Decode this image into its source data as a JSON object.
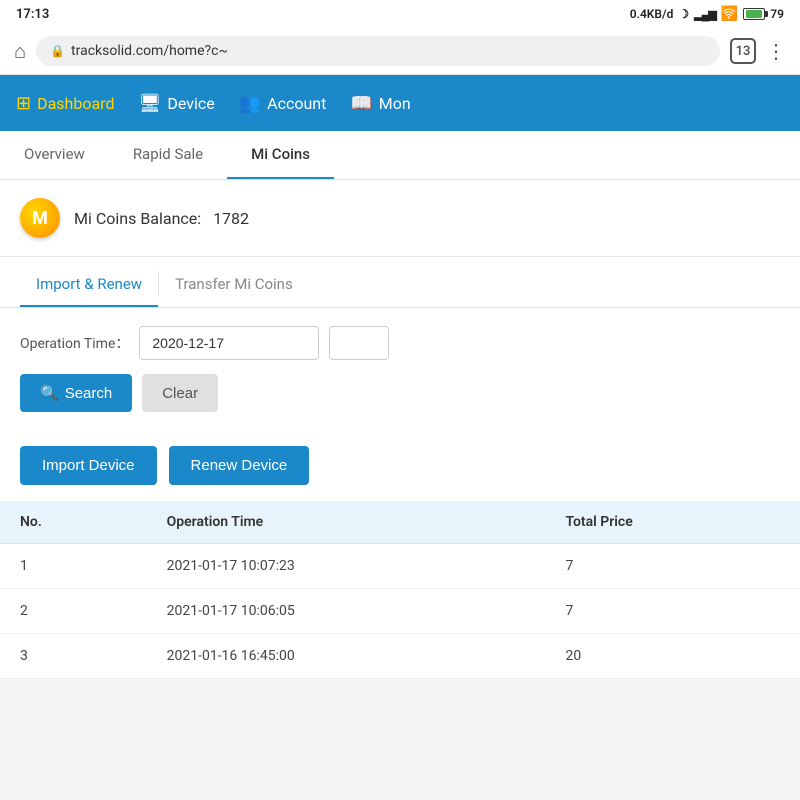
{
  "statusBar": {
    "time": "17:13",
    "network": "0.4KB/d",
    "batteryPercent": "79",
    "tabCount": "13"
  },
  "browserBar": {
    "url": "tracksolid.com/home?c~"
  },
  "nav": {
    "items": [
      {
        "id": "dashboard",
        "label": "Dashboard",
        "icon": "📊",
        "active": false
      },
      {
        "id": "device",
        "label": "Device",
        "icon": "📦",
        "active": false
      },
      {
        "id": "account",
        "label": "Account",
        "icon": "👥",
        "active": true
      },
      {
        "id": "monitor",
        "label": "Mon",
        "icon": "📖",
        "active": false
      }
    ]
  },
  "tabs": [
    {
      "id": "overview",
      "label": "Overview",
      "active": false
    },
    {
      "id": "rapid-sale",
      "label": "Rapid Sale",
      "active": false
    },
    {
      "id": "mi-coins",
      "label": "Mi Coins",
      "active": true
    }
  ],
  "balance": {
    "label": "Mi Coins Balance:",
    "amount": "1782",
    "coinSymbol": "M"
  },
  "subTabs": [
    {
      "id": "import-renew",
      "label": "Import & Renew",
      "active": true
    },
    {
      "id": "transfer",
      "label": "Transfer Mi Coins",
      "active": false
    }
  ],
  "filter": {
    "operationTimeLabel": "Operation Time：",
    "operationTimeValue": "2020-12-17",
    "searchLabel": "Search",
    "clearLabel": "Clear"
  },
  "actionButtons": {
    "importDevice": "Import Device",
    "renewDevice": "Renew Device"
  },
  "table": {
    "columns": [
      "No.",
      "Operation Time",
      "Total Price"
    ],
    "rows": [
      {
        "no": "1",
        "time": "2021-01-17 10:07:23",
        "price": "7"
      },
      {
        "no": "2",
        "time": "2021-01-17 10:06:05",
        "price": "7"
      },
      {
        "no": "3",
        "time": "2021-01-16 16:45:00",
        "price": "20"
      }
    ]
  }
}
